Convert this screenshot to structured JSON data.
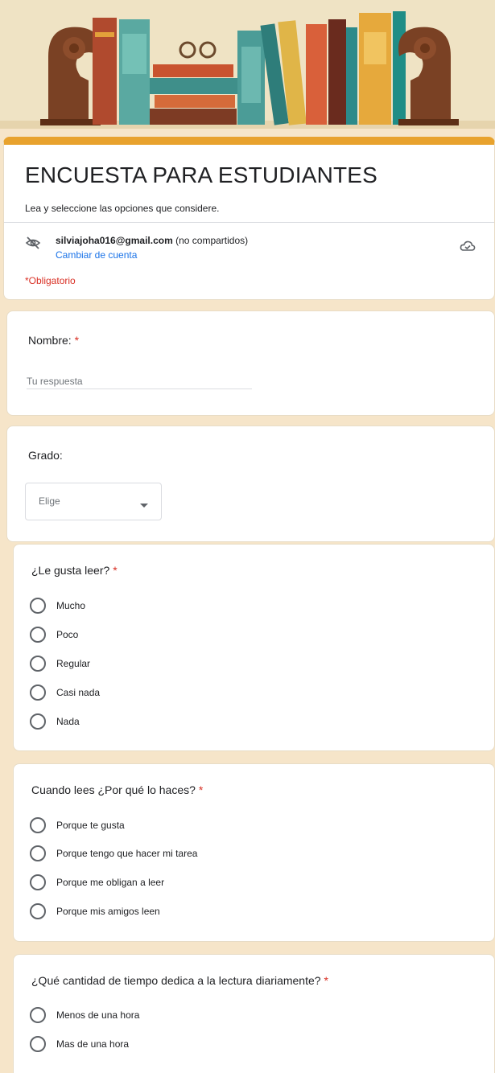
{
  "header": {
    "title": "ENCUESTA PARA ESTUDIANTES",
    "description": "Lea y seleccione las opciones que considere.",
    "account_email": "silviajoha016@gmail.com",
    "account_status": "(no compartidos)",
    "switch_account_label": "Cambiar de cuenta",
    "required_note": "*Obligatorio",
    "accent_color": "#e8a22d"
  },
  "questions": {
    "name": {
      "title": "Nombre:",
      "required_mark": "*",
      "placeholder": "Tu respuesta"
    },
    "grade": {
      "title": "Grado:",
      "select_value": "Elige"
    },
    "like_reading": {
      "title": "¿Le gusta leer?",
      "required_mark": "*",
      "options": [
        "Mucho",
        "Poco",
        "Regular",
        "Casi nada",
        "Nada"
      ]
    },
    "why_read": {
      "title": "Cuando lees ¿Por qué lo haces?",
      "required_mark": "*",
      "options": [
        "Porque te gusta",
        "Porque tengo que hacer mi tarea",
        "Porque me obligan a leer",
        "Porque mis amigos leen"
      ]
    },
    "reading_time": {
      "title": "¿Qué cantidad de tiempo dedica a la lectura diariamente?",
      "required_mark": "*",
      "options": [
        "Menos de una hora",
        "Mas de una hora"
      ]
    }
  },
  "icons": {
    "privacy": "eye-off-icon",
    "save_status": "cloud-check-icon",
    "dropdown": "caret-down-icon"
  }
}
